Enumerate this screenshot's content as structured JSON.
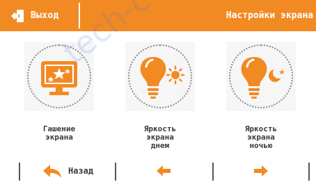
{
  "header": {
    "exit_label": "Выход",
    "title": "Настройки экрана",
    "accent_color": "#f28a24"
  },
  "tiles": [
    {
      "label_line1": "Гашение",
      "label_line2": "экрана",
      "label_line3": "",
      "icon": "screen-blanking-icon"
    },
    {
      "label_line1": "Яркость",
      "label_line2": "экрана",
      "label_line3": "днем",
      "icon": "day-brightness-icon"
    },
    {
      "label_line1": "Яркость",
      "label_line2": "экрана",
      "label_line3": "ночью",
      "icon": "night-brightness-icon"
    }
  ],
  "bottom": {
    "back_label": "Назад",
    "prev_icon": "arrow-left-icon",
    "next_icon": "arrow-right-icon"
  },
  "watermark": "tech-controllers.com"
}
